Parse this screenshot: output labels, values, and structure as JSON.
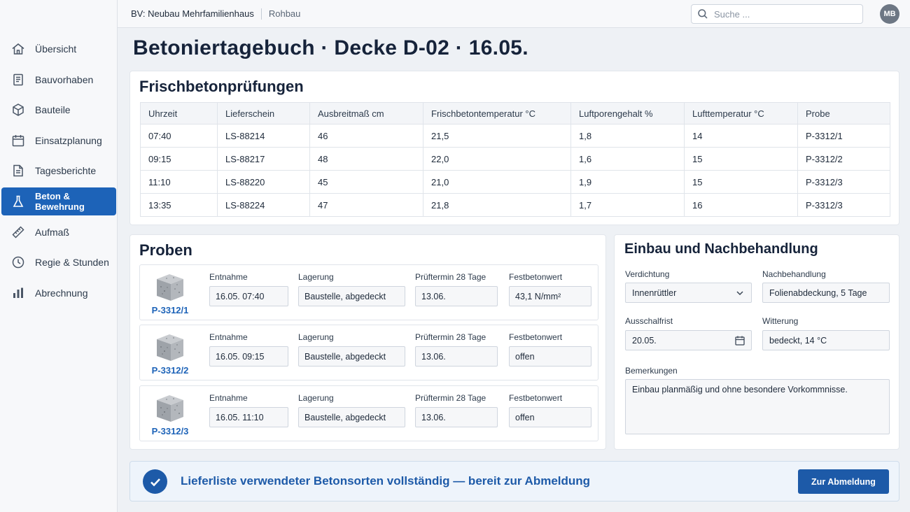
{
  "header": {
    "project": "BV: Neubau Mehrfamilienhaus",
    "phase": "Rohbau",
    "search_placeholder": "Suche ...",
    "avatar_initials": "MB"
  },
  "sidebar": {
    "items": [
      {
        "label": "Übersicht",
        "icon": "home-icon"
      },
      {
        "label": "Bauvorhaben",
        "icon": "document-icon"
      },
      {
        "label": "Bauteile",
        "icon": "cube-icon"
      },
      {
        "label": "Einsatzplanung",
        "icon": "calendar-icon"
      },
      {
        "label": "Tagesberichte",
        "icon": "report-icon"
      },
      {
        "label": "Beton & Bewehrung",
        "icon": "flask-icon",
        "active": true
      },
      {
        "label": "Aufmaß",
        "icon": "ruler-icon"
      },
      {
        "label": "Regie & Stunden",
        "icon": "clock-icon"
      },
      {
        "label": "Abrechnung",
        "icon": "bar-chart-icon"
      }
    ]
  },
  "page": {
    "title": "Betoniertagebuch · Decke D-02 · 16.05."
  },
  "tests": {
    "title": "Frischbetonprüfungen",
    "columns": [
      "Uhrzeit",
      "Lieferschein",
      "Ausbreitmaß cm",
      "Frischbetontemperatur °C",
      "Luftporengehalt %",
      "Lufttemperatur °C",
      "Probe"
    ],
    "rows": [
      [
        "07:40",
        "LS-88214",
        "46",
        "21,5",
        "1,8",
        "14",
        "P-3312/1"
      ],
      [
        "09:15",
        "LS-88217",
        "48",
        "22,0",
        "1,6",
        "15",
        "P-3312/2"
      ],
      [
        "11:10",
        "LS-88220",
        "45",
        "21,0",
        "1,9",
        "15",
        "P-3312/3"
      ],
      [
        "13:35",
        "LS-88224",
        "47",
        "21,8",
        "1,7",
        "16",
        "P-3312/3"
      ]
    ]
  },
  "samples": {
    "title": "Proben",
    "labels": {
      "entnahme": "Entnahme",
      "lagerung": "Lagerung",
      "prueftermin": "Prüftermin  28 Tage",
      "festbetonwert": "Festbetonwert"
    },
    "items": [
      {
        "id": "P-3312/1",
        "entnahme": "16.05.  07:40",
        "lagerung": "Baustelle, abgedeckt",
        "prueftermin": "13.06.",
        "festbetonwert": "43,1 N/mm²"
      },
      {
        "id": "P-3312/2",
        "entnahme": "16.05.  09:15",
        "lagerung": "Baustelle, abgedeckt",
        "prueftermin": "13.06.",
        "festbetonwert": "offen"
      },
      {
        "id": "P-3312/3",
        "entnahme": "16.05.  11:10",
        "lagerung": "Baustelle, abgedeckt",
        "prueftermin": "13.06.",
        "festbetonwert": "offen"
      }
    ]
  },
  "placement": {
    "title": "Einbau und Nachbehandlung",
    "verdichtung_label": "Verdichtung",
    "verdichtung_value": "Innenrüttler",
    "nachbehandlung_label": "Nachbehandlung",
    "nachbehandlung_value": "Folienabdeckung, 5 Tage",
    "ausschalfrist_label": "Ausschalfrist",
    "ausschalfrist_value": "20.05.",
    "witterung_label": "Witterung",
    "witterung_value": "bedeckt, 14 °C",
    "bemerkungen_label": "Bemerkungen",
    "bemerkungen_value": "Einbau planmäßig und ohne besondere Vorkommnisse."
  },
  "banner": {
    "text": "Lieferliste verwendeter Betonsorten vollständig — bereit zur Abmeldung",
    "button": "Zur Abmeldung"
  },
  "colors": {
    "accent": "#1d63b8",
    "accent_dark": "#1d5aa8"
  }
}
